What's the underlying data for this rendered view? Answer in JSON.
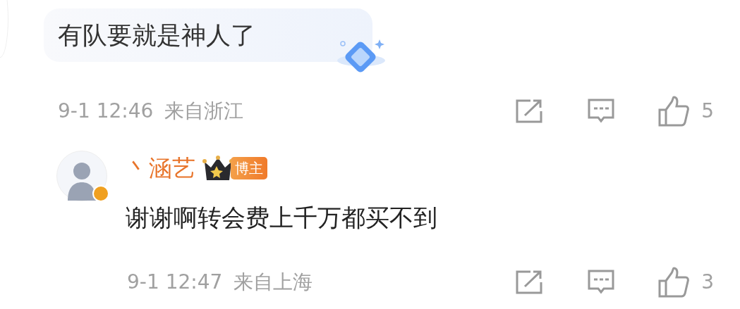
{
  "comment": {
    "text": "有队要就是神人了",
    "time": "9-1 12:46",
    "location": "来自浙江",
    "likes": "5"
  },
  "reply": {
    "author": "丶涵艺",
    "badge": "博主",
    "verified": true,
    "text": "谢谢啊转会费上千万都买不到",
    "time": "9-1 12:47",
    "location": "来自上海",
    "likes": "3"
  }
}
